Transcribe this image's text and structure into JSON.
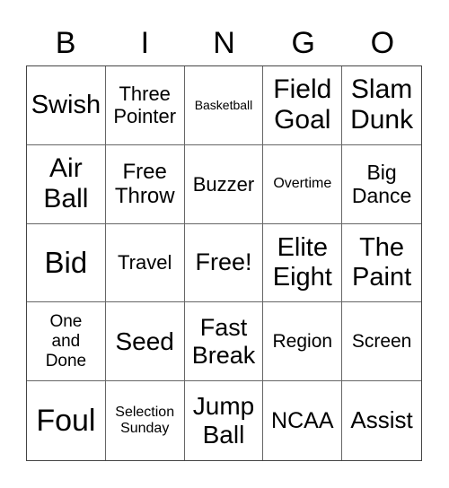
{
  "header": [
    "B",
    "I",
    "N",
    "G",
    "O"
  ],
  "cells": [
    "Swish",
    "Three\nPointer",
    "Basketball",
    "Field\nGoal",
    "Slam\nDunk",
    "Air\nBall",
    "Free\nThrow",
    "Buzzer",
    "Overtime",
    "Big\nDance",
    "Bid",
    "Travel",
    "Free!",
    "Elite\nEight",
    "The\nPaint",
    "One\nand\nDone",
    "Seed",
    "Fast\nBreak",
    "Region",
    "Screen",
    "Foul",
    "Selection\nSunday",
    "Jump\nBall",
    "NCAA",
    "Assist"
  ]
}
